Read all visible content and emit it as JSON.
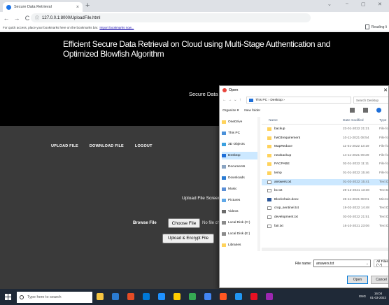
{
  "browser": {
    "tab_title": "Secure Data Retrieval",
    "tab_close": "×",
    "new_tab": "+",
    "window_controls": [
      "⌄",
      "–",
      "▢",
      "✕"
    ],
    "nav": [
      "←",
      "→",
      "C"
    ],
    "info_icon": "ⓘ",
    "url": "127.0.0.1:8000/UploadFile.html",
    "bookmarks_text": "For quick access, place your bookmarks here on the bookmarks bar.",
    "bookmarks_link": "Import bookmarks now...",
    "reading_list": "Reading li"
  },
  "page": {
    "heading": "Efficient Secure Data Retrieval on Cloud using Multi-Stage Authentication and Optimized Blowfish Algorithm",
    "subheading": "Secure Data S",
    "menu": [
      "UPLOAD FILE",
      "DOWNLOAD FILE",
      "LOGOUT"
    ],
    "screen_title": "Upload File Screer",
    "browse_label": "Browse File",
    "choose_file": "Choose File",
    "no_file": "No file ch",
    "upload_button": "Upload & Encrypt File"
  },
  "dialog": {
    "title": "Open",
    "close": "✕",
    "nav_arrows": [
      "←",
      "→",
      "⌄",
      "↑"
    ],
    "path": "This PC  ›  Desktop  ›",
    "search_placeholder": "Search Desktop",
    "organize": "Organize ▾",
    "new_folder": "New folder",
    "nav_pane": [
      {
        "label": "OneDrive",
        "color": "#ffd35c"
      },
      {
        "label": "This PC",
        "color": "#4a90d9"
      },
      {
        "label": "3D Objects",
        "color": "#3aa0e0"
      },
      {
        "label": "Desktop",
        "color": "#1e6fd9"
      },
      {
        "label": "Documents",
        "color": "#8aa4c2"
      },
      {
        "label": "Downloads",
        "color": "#2b7cd3"
      },
      {
        "label": "Music",
        "color": "#5b8fd6"
      },
      {
        "label": "Pictures",
        "color": "#5fa8e8"
      },
      {
        "label": "Videos",
        "color": "#6b6b6b"
      },
      {
        "label": "Local Disk (C:)",
        "color": "#8a8a8a"
      },
      {
        "label": "Local Disk (E:)",
        "color": "#8a8a8a"
      },
      {
        "label": "Libraries",
        "color": "#ffd35c"
      }
    ],
    "columns": [
      "Name",
      "Date modified",
      "Type"
    ],
    "files": [
      {
        "name": "backup",
        "date": "23-01-2022 21:21",
        "type": "File fol",
        "icon": "folder"
      },
      {
        "name": "hw03requirement",
        "date": "10-11-2021 08:54",
        "type": "File fol",
        "icon": "folder"
      },
      {
        "name": "MapReduce",
        "date": "11-01-2022 13:19",
        "type": "File fol",
        "icon": "folder"
      },
      {
        "name": "newbackup",
        "date": "14-11-2021 09:29",
        "type": "File fol",
        "icon": "folder"
      },
      {
        "name": "PACPABE",
        "date": "02-01-2022 11:11",
        "type": "File fol",
        "icon": "folder"
      },
      {
        "name": "temp",
        "date": "01-01-2022 15:46",
        "type": "File fol",
        "icon": "folder"
      },
      {
        "name": "answers.txt",
        "date": "01-03-2022 15:41",
        "type": "Text D",
        "icon": "txt"
      },
      {
        "name": "bc.txt",
        "date": "29-12-2021 13:38",
        "type": "Text D",
        "icon": "txt"
      },
      {
        "name": "Blockchain.docx",
        "date": "26-11-2021 08:01",
        "type": "Micros",
        "icon": "doc"
      },
      {
        "name": "crop_sentinel.txt",
        "date": "19-02-2022 14:48",
        "type": "Text D",
        "icon": "txt"
      },
      {
        "name": "development.txt",
        "date": "03-03-2022 21:51",
        "type": "Text D",
        "icon": "txt"
      },
      {
        "name": "fair.txt",
        "date": "16-10-2021 23:06",
        "type": "Text D",
        "icon": "txt"
      }
    ],
    "selected_file_index": 6,
    "selected_nav_index": 3,
    "file_name_label": "File name:",
    "file_name_value": "answers.txt",
    "file_type": "All Files (*.*)",
    "open": "Open",
    "cancel": "Cancel"
  },
  "taskbar": {
    "search_placeholder": "Type here to search",
    "time": "16:04",
    "date": "01-03-2022",
    "lang": "ENG",
    "app_colors": [
      "#f5c542",
      "#2b7cd3",
      "#e34c26",
      "#0078d7",
      "#1e90ff",
      "#ffcc00",
      "#35a853",
      "#4285f4",
      "#ff5722",
      "#2196f3",
      "#e81123",
      "#9c27b0"
    ]
  }
}
